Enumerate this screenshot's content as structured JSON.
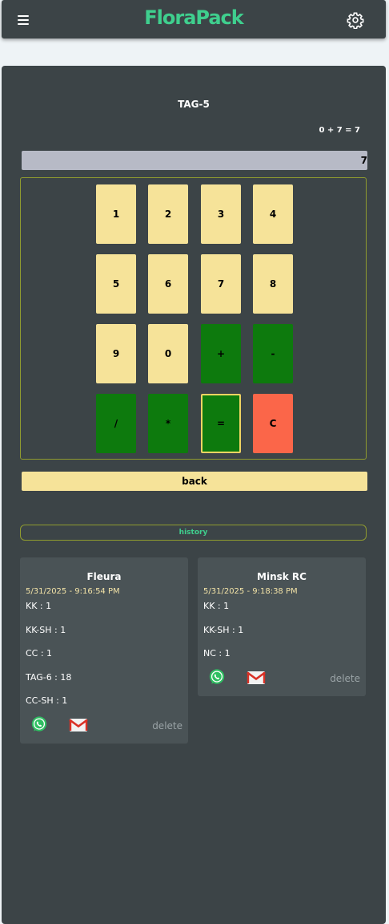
{
  "app": {
    "title": "FloraPack"
  },
  "calculator": {
    "tag": "TAG-5",
    "expression": "0 + 7 = 7",
    "display_value": "7",
    "keys": [
      "1",
      "2",
      "3",
      "4",
      "5",
      "6",
      "7",
      "8",
      "9",
      "0",
      "+",
      "-",
      "/",
      "*",
      "=",
      "C"
    ],
    "back_label": "back"
  },
  "history": {
    "label": "history",
    "entries": [
      {
        "name": "Fleura",
        "datetime": "5/31/2025 - 9:16:54 PM",
        "lines": [
          "KK : 1",
          "KK-SH : 1",
          "CC : 1",
          "TAG-6 : 18",
          "CC-SH : 1"
        ],
        "delete_label": "delete"
      },
      {
        "name": "Minsk RC",
        "datetime": "5/31/2025 - 9:18:38 PM",
        "lines": [
          "KK : 1",
          "KK-SH : 1",
          "NC : 1"
        ],
        "delete_label": "delete"
      }
    ]
  },
  "colors": {
    "background": "#eef3f6",
    "panel": "#3c4447",
    "brand": "#3fcf8e",
    "number_key": "#f6e399",
    "operator_key": "#0d7a0d",
    "clear_key": "#fb6649",
    "date_text": "#f3e3a7"
  },
  "icons": {
    "menu": "hamburger-icon",
    "settings": "gear-icon",
    "whatsapp": "whatsapp-icon",
    "email": "gmail-icon"
  }
}
